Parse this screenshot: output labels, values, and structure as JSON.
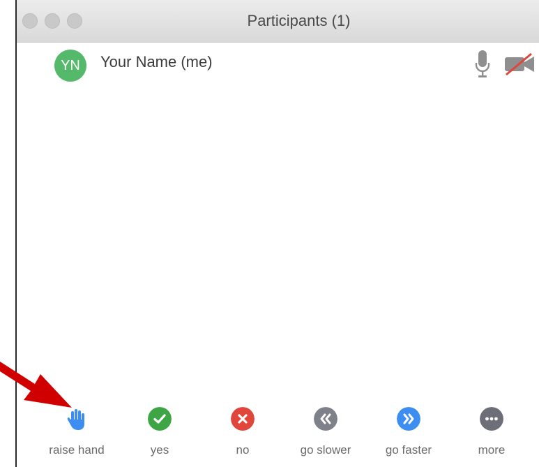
{
  "window": {
    "title": "Participants (1)"
  },
  "participants": [
    {
      "initials": "YN",
      "name": "Your Name (me)",
      "avatar_color": "#55b96b",
      "mic_icon": "microphone-icon",
      "video_icon": "video-off-icon"
    }
  ],
  "toolbar": {
    "items": [
      {
        "label": "raise hand",
        "icon": "raise-hand-icon",
        "color": "#3d8ef0"
      },
      {
        "label": "yes",
        "icon": "check-icon",
        "color": "#3ea545"
      },
      {
        "label": "no",
        "icon": "x-icon",
        "color": "#e0463b"
      },
      {
        "label": "go slower",
        "icon": "rewind-icon",
        "color": "#7e8189"
      },
      {
        "label": "go faster",
        "icon": "fast-forward-icon",
        "color": "#3d8ef0"
      },
      {
        "label": "more",
        "icon": "more-icon",
        "color": "#6c6f78"
      }
    ]
  },
  "colors": {
    "annotation_arrow": "#d10000"
  }
}
